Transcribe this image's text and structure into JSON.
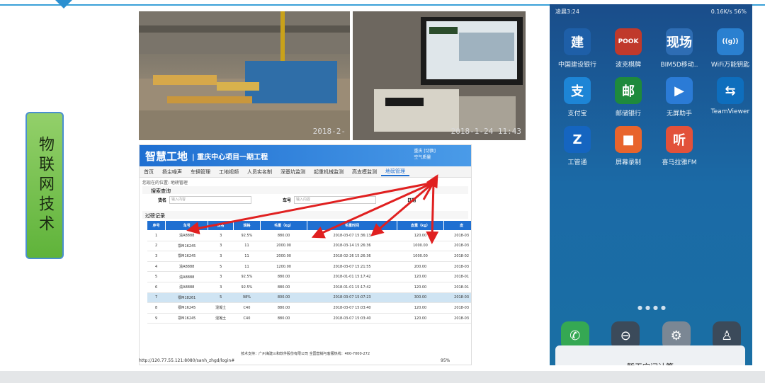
{
  "left_label": "物联网技术",
  "photos": {
    "photo1_timestamp": "2018-2-",
    "photo2_timestamp": "2018-1-24 11:43"
  },
  "webapp": {
    "logo": "智慧工地",
    "project": "| 重庆中心项目一期工程",
    "user_city": "重庆",
    "user_link": "[切换]",
    "air_quality": "空气质量",
    "nav": [
      "首页",
      "扬尘噪声",
      "车辆管理",
      "工地视频",
      "人员实名制",
      "深基坑监测",
      "起重机械监测",
      "高支模监测",
      "地磅管理"
    ],
    "breadcrumb": "您现在的位置: 地磅管理",
    "search_title": "搜索查询",
    "search_fields": {
      "goods_label": "货名",
      "goods_placeholder": "输入内容",
      "plate_label": "车号",
      "plate_placeholder": "输入内容",
      "date_label": "日期"
    },
    "section_title": "过磅记录",
    "table": {
      "headers": [
        "序号",
        "车号",
        "货名",
        "规格",
        "毛重（kg）",
        "毛重时间",
        "皮重（kg）",
        "皮"
      ],
      "rows": [
        [
          "1",
          "渝A8888",
          "3",
          "92.5%",
          "880.00",
          "2018-03-07 15:36:13",
          "120.00",
          "2018-03"
        ],
        [
          "2",
          "鄂M16245",
          "3",
          "11",
          "2000.00",
          "2018-03-14 15:26:36",
          "1000.00",
          "2018-03"
        ],
        [
          "3",
          "鄂M16245",
          "3",
          "11",
          "2000.00",
          "2018-02-26 15:26:36",
          "1000.00",
          "2018-02"
        ],
        [
          "4",
          "渝A8888",
          "5",
          "11",
          "1200.00",
          "2018-03-07 15:21:55",
          "200.00",
          "2018-03"
        ],
        [
          "5",
          "渝A8888",
          "3",
          "92.5%",
          "880.00",
          "2018-01-01 15:17:42",
          "120.00",
          "2018-01"
        ],
        [
          "6",
          "渝A8888",
          "3",
          "92.5%",
          "880.00",
          "2018-01-01 15:17:42",
          "120.00",
          "2018-01"
        ],
        [
          "7",
          "鄂M18261",
          "5",
          "98%",
          "800.00",
          "2018-03-07 15:07:23",
          "300.00",
          "2018-03"
        ],
        [
          "8",
          "鄂M16245",
          "混凝土",
          "C40",
          "880.00",
          "2018-03-07 15:03:40",
          "120.00",
          "2018-03"
        ],
        [
          "9",
          "鄂M16245",
          "混凝土",
          "C40",
          "880.00",
          "2018-03-07 15:03:40",
          "120.00",
          "2018-03"
        ]
      ],
      "highlighted_row": 7
    },
    "footer": "技术支持：广州海建三和软件股份有限公司    全国营销与客服热线：400-7000-272",
    "status_url": "http://120.77.55.121:8080/sanh_zhgd/login#",
    "zoom": "95%"
  },
  "phone": {
    "time": "凌晨3:24",
    "status_right": "0.16K/s  56%",
    "apps": [
      {
        "label": "中国建设银行",
        "color": "#1e5fa8",
        "glyph": "建"
      },
      {
        "label": "波克棋牌",
        "color": "#c0392b",
        "glyph": "POOK"
      },
      {
        "label": "BIM5D移动..",
        "color": "#2e6db4",
        "glyph": "现场"
      },
      {
        "label": "WiFi万能钥匙",
        "color": "#2a80d0",
        "glyph": "((g))"
      },
      {
        "label": "支付宝",
        "color": "#1d85d6",
        "glyph": "支"
      },
      {
        "label": "邮储银行",
        "color": "#1e8a3c",
        "glyph": "邮"
      },
      {
        "label": "无屏助手",
        "color": "#2b7bd6",
        "glyph": "▶"
      },
      {
        "label": "TeamViewer",
        "color": "#0e6ebd",
        "glyph": "⇆"
      },
      {
        "label": "工管通",
        "color": "#1565c0",
        "glyph": "Z"
      },
      {
        "label": "屏幕录制",
        "color": "#e8642c",
        "glyph": "■"
      },
      {
        "label": "喜马拉雅FM",
        "color": "#e2513a",
        "glyph": "听"
      }
    ],
    "dock": [
      {
        "name": "phone",
        "color": "#35a853",
        "glyph": "✆"
      },
      {
        "name": "lock",
        "color": "#3b4a5a",
        "glyph": "⊖"
      },
      {
        "name": "settings",
        "color": "#7b8794",
        "glyph": "⚙"
      },
      {
        "name": "flashlight",
        "color": "#3b4a5a",
        "glyph": "♙"
      }
    ],
    "popup_text": "暂无空间计算"
  }
}
